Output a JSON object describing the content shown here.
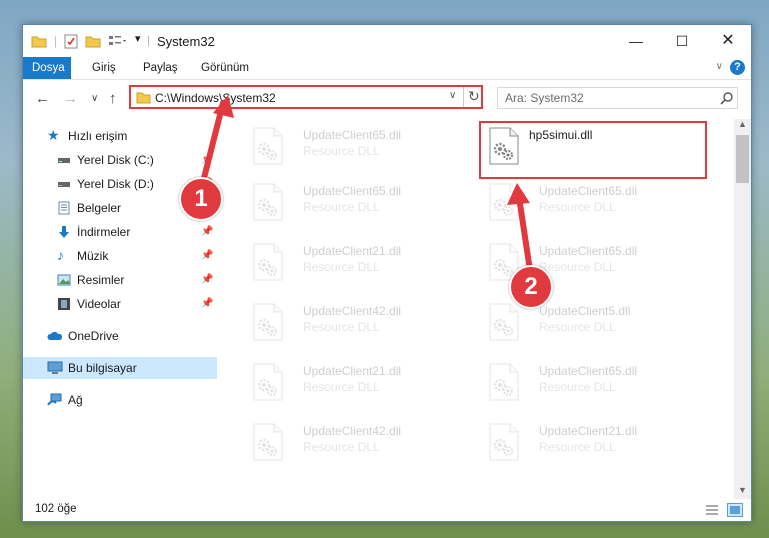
{
  "window": {
    "title": "System32"
  },
  "ribbon": {
    "tabs": [
      {
        "label": "Dosya"
      },
      {
        "label": "Giriş"
      },
      {
        "label": "Paylaş"
      },
      {
        "label": "Görünüm"
      }
    ]
  },
  "address": {
    "path": "C:\\Windows\\System32"
  },
  "search": {
    "placeholder": "Ara: System32"
  },
  "sidebar": {
    "items": [
      {
        "label": "Hızlı erişim"
      },
      {
        "label": "Yerel Disk (C:)"
      },
      {
        "label": "Yerel Disk (D:)"
      },
      {
        "label": "Belgeler"
      },
      {
        "label": "İndirmeler"
      },
      {
        "label": "Müzik"
      },
      {
        "label": "Resimler"
      },
      {
        "label": "Videolar"
      },
      {
        "label": "OneDrive"
      },
      {
        "label": "Bu bilgisayar"
      },
      {
        "label": "Ağ"
      }
    ]
  },
  "files": [
    {
      "name": "UpdateClient65.dll",
      "type": "Resource DLL"
    },
    {
      "name": "hp5simui.dll",
      "type": ""
    },
    {
      "name": "UpdateClient65.dll",
      "type": "Resource DLL"
    },
    {
      "name": "UpdateClient65.dll",
      "type": "Resource DLL"
    },
    {
      "name": "UpdateClient21.dll",
      "type": "Resource DLL"
    },
    {
      "name": "UpdateClient65.dll",
      "type": "Resource DLL"
    },
    {
      "name": "UpdateClient42.dll",
      "type": "Resource DLL"
    },
    {
      "name": "UpdateClient5.dll",
      "type": "Resource DLL"
    },
    {
      "name": "UpdateClient21.dll",
      "type": "Resource DLL"
    },
    {
      "name": "UpdateClient65.dll",
      "type": "Resource DLL"
    },
    {
      "name": "UpdateClient42.dll",
      "type": "Resource DLL"
    },
    {
      "name": "UpdateClient21.dll",
      "type": "Resource DLL"
    }
  ],
  "status": {
    "count": "102 öğe"
  },
  "annotations": {
    "step1": "1",
    "step2": "2"
  },
  "colors": {
    "accent": "#1979ca",
    "annotation_red": "#e0393e",
    "selected": "#cce8ff"
  }
}
